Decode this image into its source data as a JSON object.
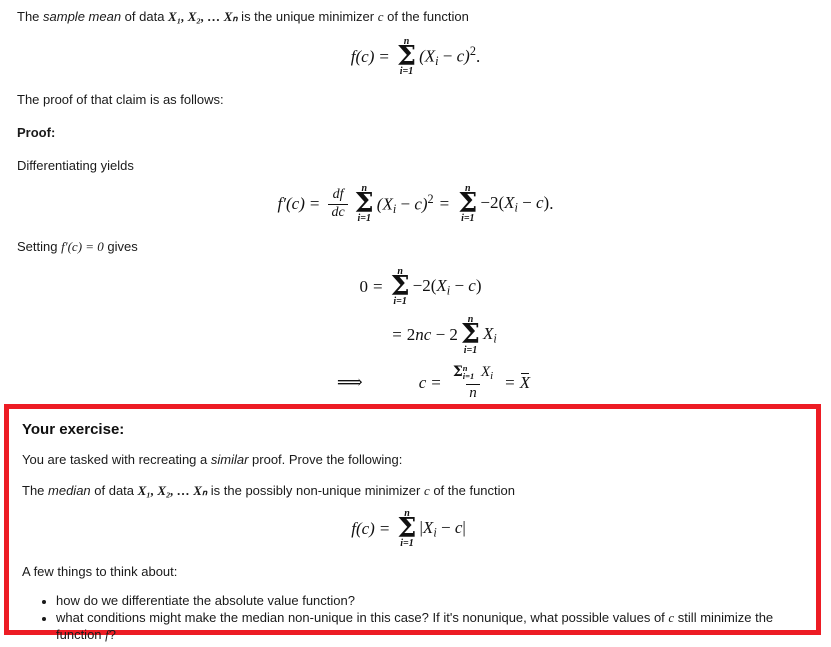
{
  "document": {
    "intro": {
      "prefix": "The ",
      "emphasis": "sample mean",
      "middle": " of data ",
      "vars": "X₁, X₂, … Xₙ",
      "suffix": " is the unique minimizer c of the function"
    },
    "proof_lead": "The proof of that claim is as follows:",
    "proof_heading": "Proof:",
    "differentiating": "Differentiating yields",
    "setting_prefix": "Setting ",
    "setting_math": "f′(c) = 0",
    "setting_suffix": " gives"
  },
  "equations": {
    "eq1": {
      "lhs": "f(c)",
      "eq": "=",
      "sum_upper": "n",
      "sum_lower": "i=1",
      "body": "(Xᵢ − c)²",
      "trailing": ".",
      "latex": "f(c) = \\sum_{i=1}^{n} (X_i - c)^2."
    },
    "eq2": {
      "lhs": "f′(c)",
      "eq": "=",
      "derivative_num": "df",
      "derivative_den": "dc",
      "sum1_upper": "n",
      "sum1_lower": "i=1",
      "body1": "(Xᵢ − c)²",
      "eq2": "=",
      "sum2_upper": "n",
      "sum2_lower": "i=1",
      "body2": "−2(Xᵢ − c)",
      "trailing": ".",
      "latex": "f'(c) = \\frac{df}{dc}\\sum_{i=1}^{n}(X_i-c)^2 = \\sum_{i=1}^{n} -2(X_i-c)."
    },
    "eq3": {
      "lhs": "0",
      "eq": "=",
      "sum_upper": "n",
      "sum_lower": "i=1",
      "body": "−2(Xᵢ − c)",
      "latex": "0 = \\sum_{i=1}^{n} -2(X_i - c)"
    },
    "eq4": {
      "eq": "=",
      "coef": "2nc − 2",
      "sum_upper": "n",
      "sum_lower": "i=1",
      "body": "Xᵢ",
      "latex": "= 2nc - 2\\sum_{i=1}^{n} X_i"
    },
    "eq5": {
      "implies": "⟹",
      "lhs": "c",
      "eq": "=",
      "numer_sum_upper": "n",
      "numer_sum_lower": "i=1",
      "numer_body": "Xᵢ",
      "denom": "n",
      "eq_b": "=",
      "rhs": "X̄",
      "latex": "\\implies c = \\frac{\\sum_{i=1}^n X_i}{n} = \\bar{X}"
    },
    "eq6": {
      "lhs": "f(c)",
      "eq": "=",
      "sum_upper": "n",
      "sum_lower": "i=1",
      "body": "|Xᵢ − c|",
      "latex": "f(c) = \\sum_{i=1}^{n} |X_i - c|"
    }
  },
  "exercise": {
    "title": "Your exercise:",
    "task_prefix": "You are tasked with recreating a ",
    "task_emphasis": "similar",
    "task_suffix": " proof. Prove the following:",
    "claim_prefix": "The ",
    "claim_emphasis": "median",
    "claim_middle": " of data ",
    "claim_vars": "X₁, X₂, … Xₙ",
    "claim_suffix": " is the possibly non-unique minimizer c of the function",
    "think_lead": "A few things to think about:",
    "bullets": [
      "how do we differentiate the absolute value function?",
      "what conditions might make the median non-unique in this case? If it's nonunique, what possible values of c still minimize the function f?"
    ],
    "border_color": "#ed1c24"
  },
  "colors": {
    "page_background": "#ffffff",
    "body_text": "#1a1a1a",
    "math_text": "#111111",
    "accent_red": "#ed1c24"
  }
}
